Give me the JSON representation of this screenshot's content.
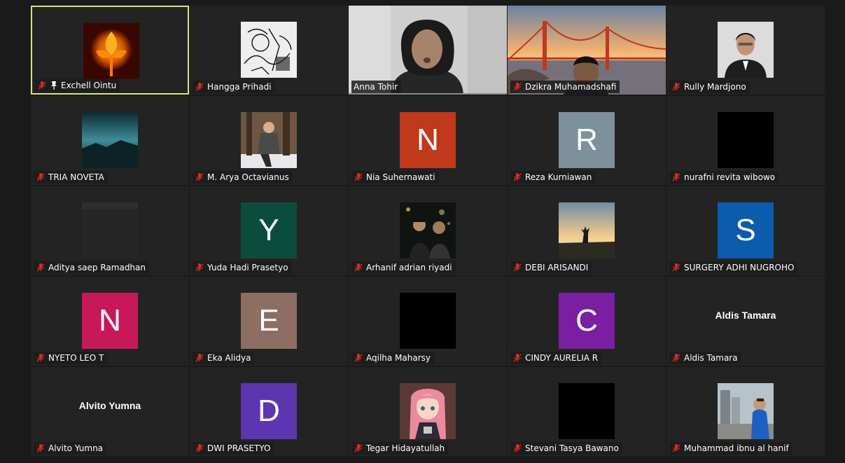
{
  "participants": [
    {
      "name": "Exchell Ointu",
      "avatar": "image",
      "image": "fire-flower",
      "muted": true,
      "pinned": true,
      "active": true
    },
    {
      "name": "Hangga Prihadi",
      "avatar": "image",
      "image": "sketch-illustration",
      "muted": true
    },
    {
      "name": "Anna Tohir",
      "avatar": "video",
      "image": "webcam-woman",
      "muted": false
    },
    {
      "name": "Dzikra Muhamadshafi",
      "avatar": "video",
      "image": "golden-gate-background",
      "muted": true
    },
    {
      "name": "Rully Mardjono",
      "avatar": "image",
      "image": "man-in-suit",
      "muted": true
    },
    {
      "name": "TRIA NOVETA",
      "avatar": "image",
      "image": "night-landscape",
      "muted": true
    },
    {
      "name": "M. Arya Octavianus",
      "avatar": "image",
      "image": "person-in-snow",
      "muted": true
    },
    {
      "name": "Nia Suhernawati",
      "avatar": "letter",
      "letter": "N",
      "color": "#c0391b",
      "muted": true
    },
    {
      "name": "Reza Kurniawan",
      "avatar": "letter",
      "letter": "R",
      "color": "#7d919d",
      "muted": true
    },
    {
      "name": "nurafni revita wibowo",
      "avatar": "image",
      "image": "black",
      "muted": true
    },
    {
      "name": "Aditya saep Ramadhan",
      "avatar": "image",
      "image": "dark-grey",
      "muted": true
    },
    {
      "name": "Yuda Hadi Prasetyo",
      "avatar": "letter",
      "letter": "Y",
      "color": "#0b4d3c",
      "muted": true
    },
    {
      "name": "Arhanif adrian riyadi",
      "avatar": "image",
      "image": "group-night",
      "muted": true
    },
    {
      "name": "DEBI ARISANDI",
      "avatar": "image",
      "image": "sunset-silhouette",
      "muted": true
    },
    {
      "name": "SURGERY ADHI NUGROHO",
      "avatar": "letter",
      "letter": "S",
      "color": "#0b5cad",
      "muted": true
    },
    {
      "name": "NYETO LEO T",
      "avatar": "letter",
      "letter": "N",
      "color": "#c7185a",
      "muted": true
    },
    {
      "name": "Eka Alidya",
      "avatar": "letter",
      "letter": "E",
      "color": "#8d6e63",
      "muted": true
    },
    {
      "name": "Aqilha Maharsy",
      "avatar": "image",
      "image": "black",
      "muted": true
    },
    {
      "name": "CINDY AURELIA R",
      "avatar": "letter",
      "letter": "C",
      "color": "#7b1fa2",
      "muted": true
    },
    {
      "name": "Aldis Tamara",
      "avatar": "name",
      "display": "Aldis Tamara",
      "muted": true
    },
    {
      "name": "Alvito Yumna",
      "avatar": "name",
      "display": "Alvito Yumna",
      "muted": true
    },
    {
      "name": "DWI PRASETYO",
      "avatar": "letter",
      "letter": "D",
      "color": "#5e35b1",
      "muted": true
    },
    {
      "name": "Tegar Hidayatullah",
      "avatar": "image",
      "image": "anime-character",
      "muted": true
    },
    {
      "name": "Stevani Tasya Bawano",
      "avatar": "image",
      "image": "black",
      "muted": true
    },
    {
      "name": "Muhammad ibnu al hanif",
      "avatar": "image",
      "image": "boy-in-city",
      "muted": true
    }
  ],
  "colors": {
    "active_border": "#d4e57a",
    "mic_off": "#e02828",
    "tile_bg": "#232323",
    "page_bg": "#1a1a1a"
  }
}
